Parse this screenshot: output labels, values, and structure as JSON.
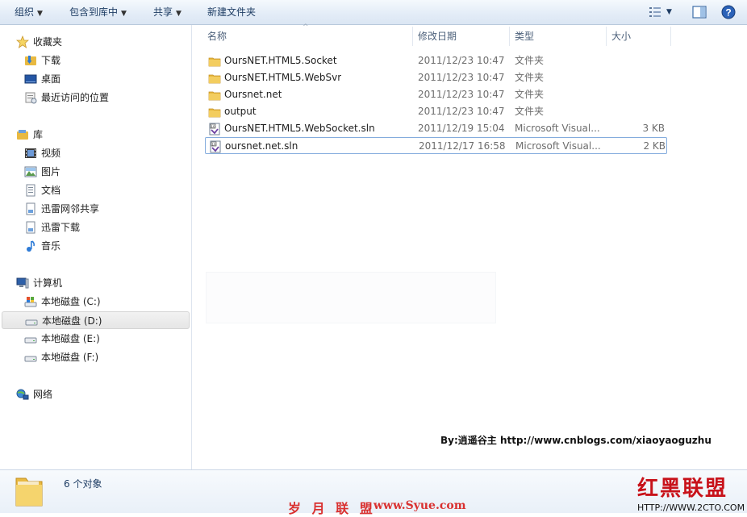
{
  "toolbar": {
    "organize": "组织",
    "include_in_library": "包含到库中",
    "share": "共享",
    "new_folder": "新建文件夹",
    "icons": [
      "view-details-icon",
      "chevron-down-icon",
      "preview-pane-icon",
      "help-icon"
    ]
  },
  "nav": {
    "favorites": {
      "label": "收藏夹",
      "icon": "star-icon"
    },
    "favorites_items": [
      {
        "label": "下载",
        "icon": "download-folder-icon"
      },
      {
        "label": "桌面",
        "icon": "desktop-icon"
      },
      {
        "label": "最近访问的位置",
        "icon": "recent-places-icon"
      }
    ],
    "libraries": {
      "label": "库",
      "icon": "library-icon"
    },
    "library_items": [
      {
        "label": "视频",
        "icon": "video-icon"
      },
      {
        "label": "图片",
        "icon": "pictures-icon"
      },
      {
        "label": "文档",
        "icon": "documents-icon"
      },
      {
        "label": "迅雷网邻共享",
        "icon": "document-icon"
      },
      {
        "label": "迅雷下载",
        "icon": "document-icon"
      },
      {
        "label": "音乐",
        "icon": "music-icon"
      }
    ],
    "computer": {
      "label": "计算机",
      "icon": "computer-icon"
    },
    "drives": [
      {
        "label": "本地磁盘 (C:)",
        "icon": "system-drive-icon"
      },
      {
        "label": "本地磁盘 (D:)",
        "icon": "drive-icon",
        "selected": true
      },
      {
        "label": "本地磁盘 (E:)",
        "icon": "drive-icon"
      },
      {
        "label": "本地磁盘 (F:)",
        "icon": "drive-icon"
      }
    ],
    "network": {
      "label": "网络",
      "icon": "network-icon"
    }
  },
  "columns": {
    "name": "名称",
    "date": "修改日期",
    "type": "类型",
    "size": "大小"
  },
  "files": [
    {
      "name": "OursNET.HTML5.Socket",
      "date": "2011/12/23 10:47",
      "type": "文件夹",
      "size": "",
      "icon": "folder-icon"
    },
    {
      "name": "OursNET.HTML5.WebSvr",
      "date": "2011/12/23 10:47",
      "type": "文件夹",
      "size": "",
      "icon": "folder-icon"
    },
    {
      "name": "Oursnet.net",
      "date": "2011/12/23 10:47",
      "type": "文件夹",
      "size": "",
      "icon": "folder-icon"
    },
    {
      "name": "output",
      "date": "2011/12/23 10:47",
      "type": "文件夹",
      "size": "",
      "icon": "folder-icon"
    },
    {
      "name": "OursNET.HTML5.WebSocket.sln",
      "date": "2011/12/19 15:04",
      "type": "Microsoft Visual...",
      "size": "3 KB",
      "icon": "vs-solution-icon"
    },
    {
      "name": "oursnet.net.sln",
      "date": "2011/12/17 16:58",
      "type": "Microsoft Visual...",
      "size": "2 KB",
      "icon": "vs-solution-icon",
      "selected": true
    }
  ],
  "credit": "By:逍遥谷主  http://www.cnblogs.com/xiaoyaoguzhu",
  "status": {
    "count": "6 个对象",
    "icon": "folder-icon"
  },
  "watermarks": {
    "left_cn": "岁 月 联 盟",
    "left_url": "www.Syue.com",
    "right_cn": "红黑联盟",
    "right_url": "HTTP://WWW.2CTO.COM"
  },
  "colors": {
    "accent": "#84acdd",
    "selection_bg": "#e6e6e6",
    "folder": "#e8b941",
    "watermark": "#d9302f"
  }
}
